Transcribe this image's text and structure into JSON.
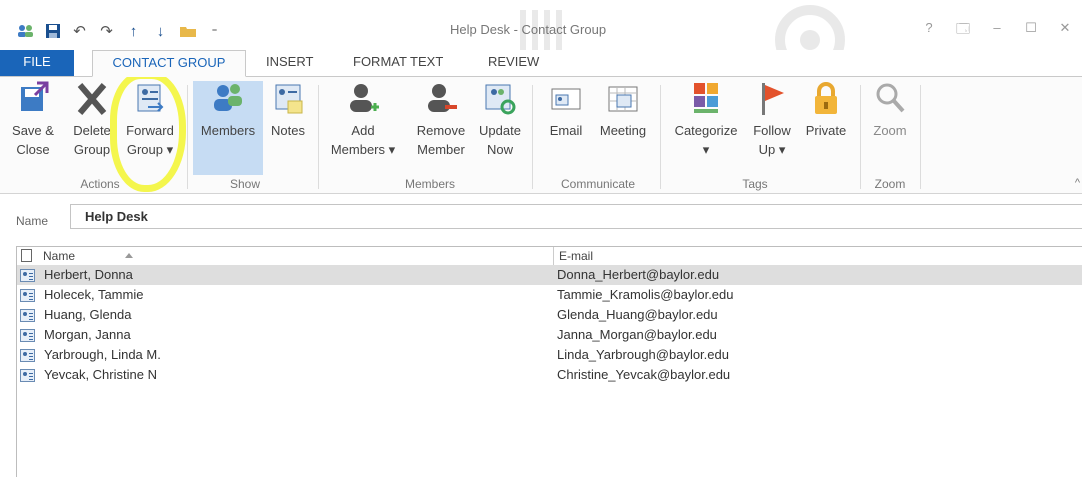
{
  "window": {
    "title": "Help Desk - Contact Group",
    "help": "?",
    "restore": "🗔",
    "minimize": "–",
    "maximize": "☐",
    "close": "✕"
  },
  "qat": [
    "contacts-icon",
    "save-icon",
    "undo-icon",
    "redo-icon",
    "up-arrow-icon",
    "down-arrow-icon",
    "folder-icon",
    "customize-icon"
  ],
  "tabs": {
    "file": "FILE",
    "contact_group": "CONTACT GROUP",
    "insert": "INSERT",
    "format_text": "FORMAT TEXT",
    "review": "REVIEW"
  },
  "ribbon": {
    "save_close": "Save &\nClose",
    "delete_group": "Delete\nGroup",
    "forward_group": "Forward\nGroup ▾",
    "members": "Members",
    "notes": "Notes",
    "add_members": "Add\nMembers ▾",
    "remove_member": "Remove\nMember",
    "update_now": "Update\nNow",
    "email": "Email",
    "meeting": "Meeting",
    "categorize": "Categorize\n▾",
    "follow_up": "Follow\nUp ▾",
    "private": "Private",
    "zoom": "Zoom",
    "groups": {
      "actions": "Actions",
      "show": "Show",
      "members": "Members",
      "communicate": "Communicate",
      "tags": "Tags",
      "zoom": "Zoom"
    }
  },
  "name_field": {
    "label": "Name",
    "value": "Help Desk"
  },
  "list": {
    "columns": {
      "name": "Name",
      "email": "E-mail"
    },
    "rows": [
      {
        "name": "Herbert, Donna",
        "email": "Donna_Herbert@baylor.edu"
      },
      {
        "name": "Holecek, Tammie",
        "email": "Tammie_Kramolis@baylor.edu"
      },
      {
        "name": "Huang, Glenda",
        "email": "Glenda_Huang@baylor.edu"
      },
      {
        "name": "Morgan, Janna",
        "email": "Janna_Morgan@baylor.edu"
      },
      {
        "name": "Yarbrough, Linda M.",
        "email": "Linda_Yarbrough@baylor.edu"
      },
      {
        "name": "Yevcak, Christine N",
        "email": "Christine_Yevcak@baylor.edu"
      }
    ]
  },
  "colors": {
    "accent": "#1a65b9",
    "selected_button": "#c6dcf3",
    "highlight_circle": "#f3f53a",
    "selected_row": "#dedede"
  }
}
